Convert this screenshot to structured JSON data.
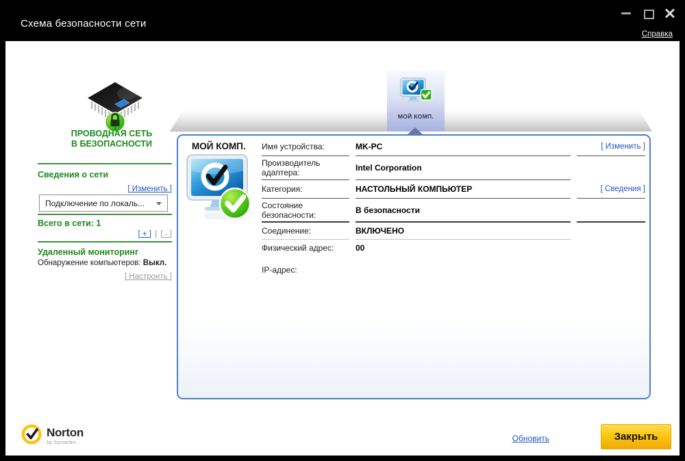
{
  "window": {
    "title": "Схема безопасности сети",
    "help_link": "Справка"
  },
  "sidebar": {
    "status": {
      "line1": "ПРОВОДНАЯ СЕТЬ",
      "line2": "В БЕЗОПАСНОСТИ",
      "icon": "chip-lock-icon"
    },
    "network": {
      "heading": "Сведения о сети",
      "edit_link": "[ Изменить ]",
      "adapter_value": "Подключение по локаль...",
      "total": "Всего в сети: 1",
      "add_link": "[ + ]",
      "separator": "|",
      "remove_link": "[ - ]"
    },
    "remote": {
      "heading": "Удаленный мониторинг",
      "discovery_label": "Обнаружение компьютеров:",
      "discovery_value": "Выкл.",
      "configure_link": "[ Настроить ]"
    }
  },
  "device_strip": {
    "selected_tab": "МОЙ КОМП.",
    "selected_tab_icon": "computer-check-icon"
  },
  "panel": {
    "title": "МОЙ КОМП.",
    "device_icon": "computer-secure-icon",
    "rows": [
      {
        "label": "Имя устройства:",
        "value": "MK-PC",
        "action": "[ Изменить ]"
      },
      {
        "label": "Производитель адаптера:",
        "value": "Intel Corporation",
        "action": ""
      },
      {
        "label": "Категория:",
        "value": "НАСТОЛЬНЫЙ КОМПЬЮТЕР",
        "action": "[ Сведения ]"
      },
      {
        "label": "Состояние безопасности:",
        "value": "В безопасности",
        "action": ""
      },
      {
        "label": "Соединение:",
        "value": "ВКЛЮЧЕНО",
        "action": ""
      },
      {
        "label": "Физический адрес:",
        "value": "00",
        "action": ""
      },
      {
        "label": "IP-адрес:",
        "value": "",
        "action": ""
      }
    ]
  },
  "footer": {
    "brand": "Norton",
    "brand_sub": "by Symantec",
    "refresh_link": "Обновить",
    "close_button": "Закрыть"
  },
  "colors": {
    "accent_green": "#1b8a1b",
    "separator_green": "#3f8f3f",
    "link_blue": "#2257c5",
    "disabled_gray": "#9b9b9b",
    "panel_border_blue": "#4d80c4",
    "tab_lavender": "#a7b1df",
    "button_yellow": "#fcc70f",
    "titlebar_black": "#000000",
    "norton_yellow": "#ffc20e",
    "badge_green": "#2fae12"
  }
}
